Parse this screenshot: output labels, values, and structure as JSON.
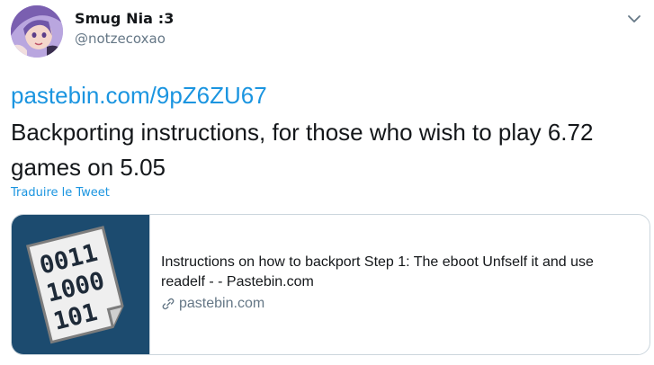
{
  "user": {
    "display_name": "Smug Nia :3",
    "handle": "@notzecoxao"
  },
  "tweet": {
    "link": "pastebin.com/9pZ6ZU67",
    "text": "Backporting instructions, for those who wish to play 6.72 games on 5.05",
    "translate_label": "Traduire le Tweet"
  },
  "card": {
    "image_text": [
      "0011",
      "1000",
      "101"
    ],
    "title": "Instructions on how to backport Step 1: The eboot Unfself it and use readelf - - Pastebin.com",
    "domain": "pastebin.com",
    "domain_icon": "link-icon",
    "image_icon": "binary-document-icon"
  },
  "icons": {
    "menu": "chevron-down-icon",
    "avatar": "avatar"
  },
  "colors": {
    "link": "#1b95e0",
    "secondary_text": "#657786",
    "card_image_bg": "#1c4b6f",
    "border": "#ccd6dd"
  }
}
